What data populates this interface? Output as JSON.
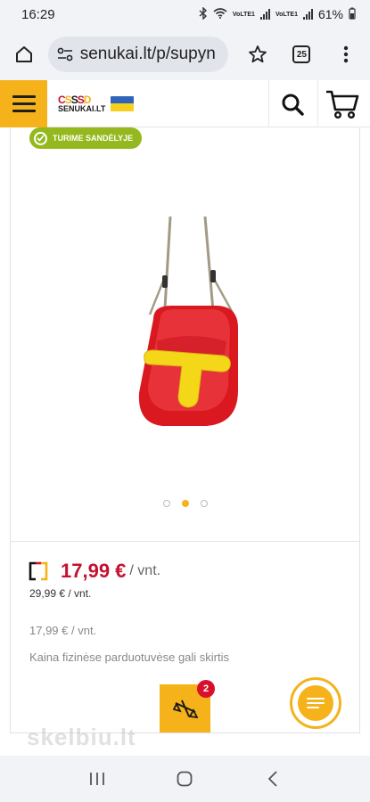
{
  "status_bar": {
    "time": "16:29",
    "network_label_1": "VoLTE1",
    "network_label_2": "VoLTE1",
    "battery": "61%"
  },
  "browser": {
    "url": "senukai.lt/p/supyn",
    "tabs_count": "25",
    "icons": [
      "home-icon",
      "site-settings-icon",
      "star-icon",
      "tabs-icon",
      "more-vert-icon"
    ]
  },
  "site_header": {
    "logo_marks": "CSSSD",
    "logo_name": "SENUKAI.LT",
    "flag_colors": [
      "#2f64b8",
      "#f6d01c"
    ],
    "accent": "#f5b21a"
  },
  "product": {
    "stock_badge": "TURIME SANDĖLYJE",
    "image_dots": {
      "count": 3,
      "active_index": 1
    },
    "price": "17,99 €",
    "price_unit": "/ vnt.",
    "old_price": "29,99 € / vnt.",
    "alt_price": "17,99 € / vnt.",
    "note": "Kaina fizinėse parduotuvėse gali skirtis",
    "price_color": "#c41230"
  },
  "floating": {
    "compare_count": "2"
  },
  "watermark": "skelbiu.lt"
}
